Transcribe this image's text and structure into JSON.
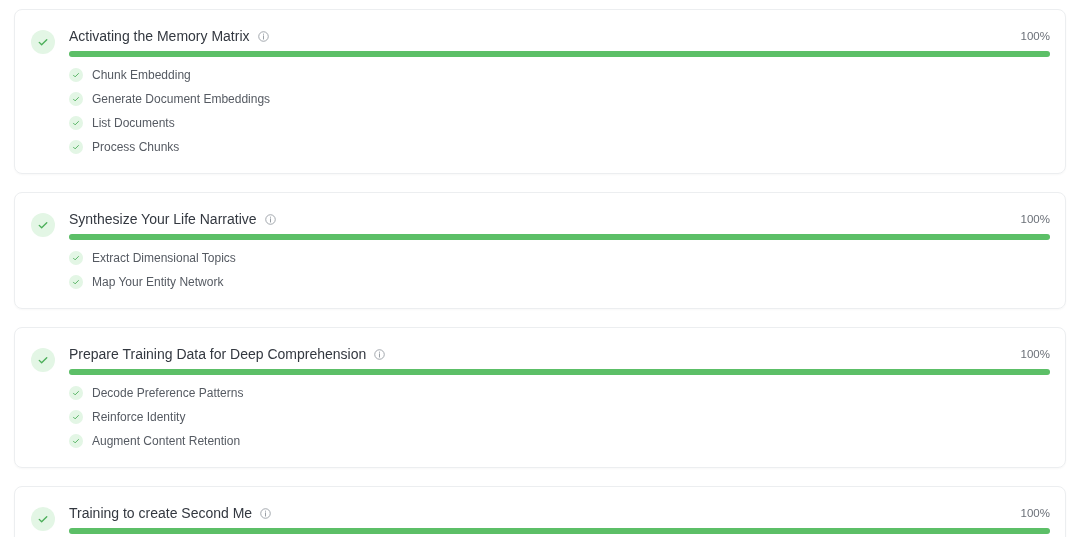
{
  "stages": [
    {
      "title": "Activating the Memory Matrix",
      "done": true,
      "percent": "100%",
      "level": 1,
      "steps": [
        {
          "label": "Chunk Embedding",
          "done": true
        },
        {
          "label": "Generate Document Embeddings",
          "done": true
        },
        {
          "label": "List Documents",
          "done": true
        },
        {
          "label": "Process Chunks",
          "done": true
        }
      ]
    },
    {
      "title": "Synthesize Your Life Narrative",
      "done": true,
      "percent": "100%",
      "level": 1,
      "steps": [
        {
          "label": "Extract Dimensional Topics",
          "done": true
        },
        {
          "label": "Map Your Entity Network",
          "done": true
        }
      ]
    },
    {
      "title": "Prepare Training Data for Deep Comprehension",
      "done": true,
      "percent": "100%",
      "level": 1,
      "steps": [
        {
          "label": "Decode Preference Patterns",
          "done": true
        },
        {
          "label": "Reinforce Identity",
          "done": true
        },
        {
          "label": "Augment Content Retention",
          "done": true
        }
      ]
    },
    {
      "title": "Training to create Second Me",
      "done": true,
      "percent": "100%",
      "level": 1
    }
  ]
}
